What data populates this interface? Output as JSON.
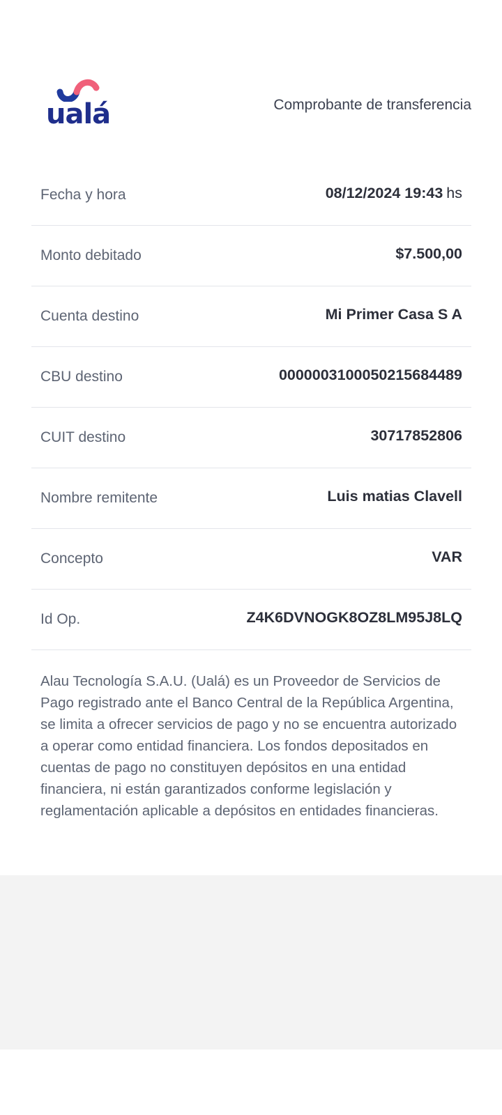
{
  "brand": {
    "logo_text": "ualá",
    "logo_colors": {
      "wordmark": "#1f2e8c",
      "wave_blue": "#1f3a9e",
      "wave_pink": "#f0607a"
    }
  },
  "header": {
    "title": "Comprobante de transferencia"
  },
  "fields": [
    {
      "label": "Fecha y hora",
      "value": "08/12/2024 19:43",
      "unit": "hs"
    },
    {
      "label": "Monto debitado",
      "value": "$7.500,00"
    },
    {
      "label": "Cuenta destino",
      "value": "Mi Primer Casa S A"
    },
    {
      "label": "CBU destino",
      "value": "0000003100050215684489"
    },
    {
      "label": "CUIT destino",
      "value": "30717852806"
    },
    {
      "label": "Nombre remitente",
      "value": "Luis matias Clavell"
    },
    {
      "label": "Concepto",
      "value": "VAR"
    },
    {
      "label": "Id Op.",
      "value": "Z4K6DVNOGK8OZ8LM95J8LQ"
    }
  ],
  "disclaimer": "Alau Tecnología S.A.U. (Ualá) es un Proveedor de Servicios de Pago registrado ante el Banco Central de la República Argentina, se limita a ofrecer servicios de pago y no se encuentra autorizado a operar como entidad financiera. Los fondos depositados en cuentas de pago no constituyen depósitos en una entidad financiera, ni están garantizados conforme legislación y reglamentación aplicable a depósitos en entidades financieras."
}
